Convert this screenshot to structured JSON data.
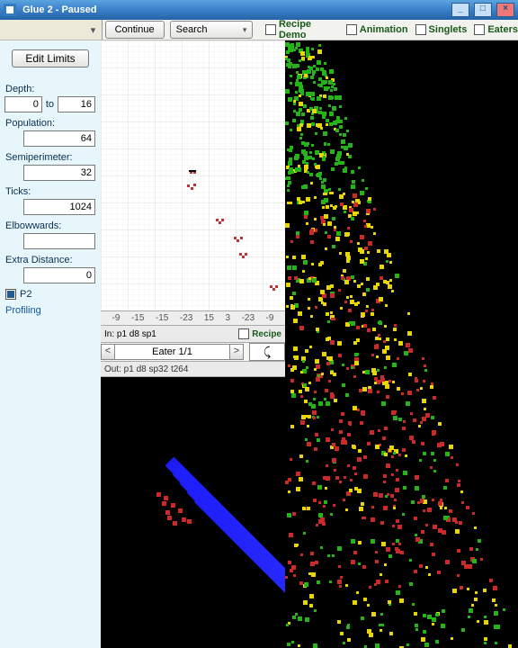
{
  "window": {
    "title": "Glue 2 - Paused"
  },
  "toolbar": {
    "continue": "Continue",
    "search": "Search",
    "recipe_demo": "Recipe Demo",
    "animation": "Animation",
    "singlets": "Singlets",
    "eaters": "Eaters"
  },
  "sidebar": {
    "edit_limits": "Edit Limits",
    "depth": {
      "label": "Depth:",
      "from": "0",
      "to_word": "to",
      "to": "16"
    },
    "population": {
      "label": "Population:",
      "value": "64"
    },
    "semiperimeter": {
      "label": "Semiperimeter:",
      "value": "32"
    },
    "ticks": {
      "label": "Ticks:",
      "value": "1024"
    },
    "elbowwards": {
      "label": "Elbowwards:",
      "value": ""
    },
    "extra_distance": {
      "label": "Extra Distance:",
      "value": "0"
    },
    "p2": "P2",
    "profiling": "Profiling"
  },
  "ruler": {
    "ticks": [
      "-9",
      "-15",
      "-15",
      "-23",
      "15",
      "3",
      "-23",
      "-9"
    ]
  },
  "eater": {
    "in": "In: p1 d8 sp1",
    "recipe": "Recipe",
    "label": "Eater 1/1",
    "out": "Out: p1 d8 sp32 t264"
  }
}
